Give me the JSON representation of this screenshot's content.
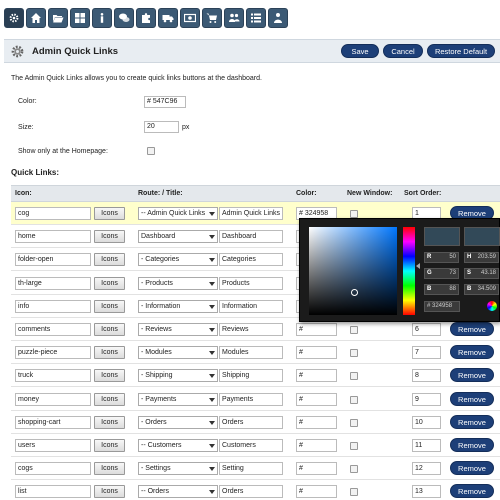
{
  "toolbar": {
    "items": [
      {
        "icon": "gear-icon"
      },
      {
        "icon": "home-icon"
      },
      {
        "icon": "folder-open-icon"
      },
      {
        "icon": "th-large-icon"
      },
      {
        "icon": "info-icon"
      },
      {
        "icon": "comments-icon"
      },
      {
        "icon": "puzzle-piece-icon"
      },
      {
        "icon": "truck-icon"
      },
      {
        "icon": "money-icon"
      },
      {
        "icon": "shopping-cart-icon"
      },
      {
        "icon": "users-icon"
      },
      {
        "icon": "list-icon"
      },
      {
        "icon": "sitemap-icon"
      }
    ]
  },
  "header": {
    "title": "Admin Quick Links",
    "save": "Save",
    "cancel": "Cancel",
    "restore": "Restore Default"
  },
  "intro": "The Admin Quick Links allows you to create quick links buttons at the dashboard.",
  "settings": {
    "color_label": "Color:",
    "color_value": "# 547C96",
    "size_label": "Size:",
    "size_value": "20",
    "size_unit": "px",
    "homepage_label": "Show only at the Homepage:",
    "homepage_checked": false
  },
  "section_title": "Quick Links:",
  "columns": {
    "icon": "Icon:",
    "route": "Route: / Title:",
    "color": "Color:",
    "new_window": "New Window:",
    "sort": "Sort Order:"
  },
  "icons_button": "Icons",
  "remove_button": "Remove",
  "rows": [
    {
      "icon": "cog",
      "route": "-- Admin Quick Links",
      "title": "Admin Quick Links",
      "color": "# 324958",
      "sort": "1",
      "highlight": true
    },
    {
      "icon": "home",
      "route": "Dashboard",
      "title": "Dashboard",
      "color": "#",
      "sort": ""
    },
    {
      "icon": "folder-open",
      "route": "- Categories",
      "title": "Categories",
      "color": "#",
      "sort": ""
    },
    {
      "icon": "th-large",
      "route": "- Products",
      "title": "Products",
      "color": "#",
      "sort": ""
    },
    {
      "icon": "info",
      "route": "- Information",
      "title": "Information",
      "color": "#",
      "sort": ""
    },
    {
      "icon": "comments",
      "route": "- Reviews",
      "title": "Reviews",
      "color": "#",
      "sort": "6"
    },
    {
      "icon": "puzzle-piece",
      "route": "- Modules",
      "title": "Modules",
      "color": "#",
      "sort": "7"
    },
    {
      "icon": "truck",
      "route": "- Shipping",
      "title": "Shipping",
      "color": "#",
      "sort": "8"
    },
    {
      "icon": "money",
      "route": "- Payments",
      "title": "Payments",
      "color": "#",
      "sort": "9"
    },
    {
      "icon": "shopping-cart",
      "route": "- Orders",
      "title": "Orders",
      "color": "#",
      "sort": "10"
    },
    {
      "icon": "users",
      "route": "-- Customers",
      "title": "Customers",
      "color": "#",
      "sort": "11"
    },
    {
      "icon": "cogs",
      "route": "- Settings",
      "title": "Setting",
      "color": "#",
      "sort": "12"
    },
    {
      "icon": "list",
      "route": "-- Orders",
      "title": "Orders",
      "color": "#",
      "sort": "13"
    }
  ],
  "picker": {
    "r_label": "R",
    "r_value": "50",
    "g_label": "G",
    "g_value": "73",
    "b_label": "B",
    "b_value": "88",
    "h_label": "H",
    "h_value": "203.59",
    "s_label": "S",
    "s_value": "43.18",
    "b2_label": "B",
    "b2_value": "34.509",
    "hex": "# 324958",
    "color": "#324958"
  }
}
